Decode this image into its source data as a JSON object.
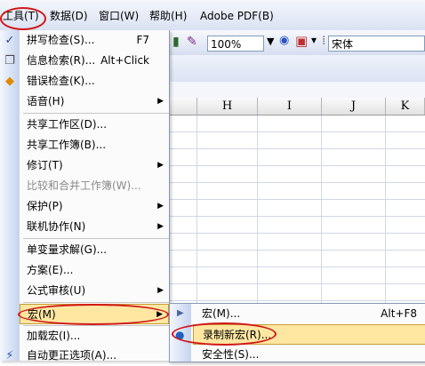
{
  "menubar": {
    "items": [
      {
        "label": "工具(T)"
      },
      {
        "label": "数据(D)"
      },
      {
        "label": "窗口(W)"
      },
      {
        "label": "帮助(H)"
      },
      {
        "label": "Adobe PDF(B)"
      }
    ]
  },
  "toolbar": {
    "zoom": "100%",
    "font": "宋体"
  },
  "columns": [
    "H",
    "I",
    "J",
    "K"
  ],
  "tools_menu": {
    "items": [
      {
        "label": "拼写检查(S)...",
        "shortcut": "F7",
        "icon": "spell-check-icon"
      },
      {
        "label": "信息检索(R)...",
        "shortcut": "Alt+Click",
        "icon": "research-icon"
      },
      {
        "label": "错误检查(K)...",
        "shortcut": "",
        "icon": "error-check-icon"
      },
      {
        "label": "语音(H)",
        "shortcut": "",
        "submenu": true
      },
      {
        "label": "共享工作区(D)...",
        "shortcut": ""
      },
      {
        "label": "共享工作簿(B)...",
        "shortcut": ""
      },
      {
        "label": "修订(T)",
        "shortcut": "",
        "submenu": true
      },
      {
        "label": "比较和合并工作簿(W)...",
        "shortcut": "",
        "disabled": true
      },
      {
        "label": "保护(P)",
        "shortcut": "",
        "submenu": true
      },
      {
        "label": "联机协作(N)",
        "shortcut": "",
        "submenu": true
      },
      {
        "label": "单变量求解(G)...",
        "shortcut": ""
      },
      {
        "label": "方案(E)...",
        "shortcut": ""
      },
      {
        "label": "公式审核(U)",
        "shortcut": "",
        "submenu": true
      },
      {
        "label": "宏(M)",
        "shortcut": "",
        "submenu": true,
        "active": true
      },
      {
        "label": "加载宏(I)...",
        "shortcut": ""
      },
      {
        "label": "自动更正选项(A)...",
        "shortcut": "",
        "icon": "autocorrect-icon"
      }
    ]
  },
  "macro_submenu": {
    "items": [
      {
        "label": "宏(M)...",
        "shortcut": "Alt+F8",
        "icon": "run-macro-icon"
      },
      {
        "label": "录制新宏(R)...",
        "shortcut": "",
        "icon": "record-macro-icon"
      },
      {
        "label": "安全性(S)...",
        "shortcut": ""
      }
    ]
  },
  "colors": {
    "highlight": "#ffe7a2",
    "annotation": "#d01818"
  }
}
